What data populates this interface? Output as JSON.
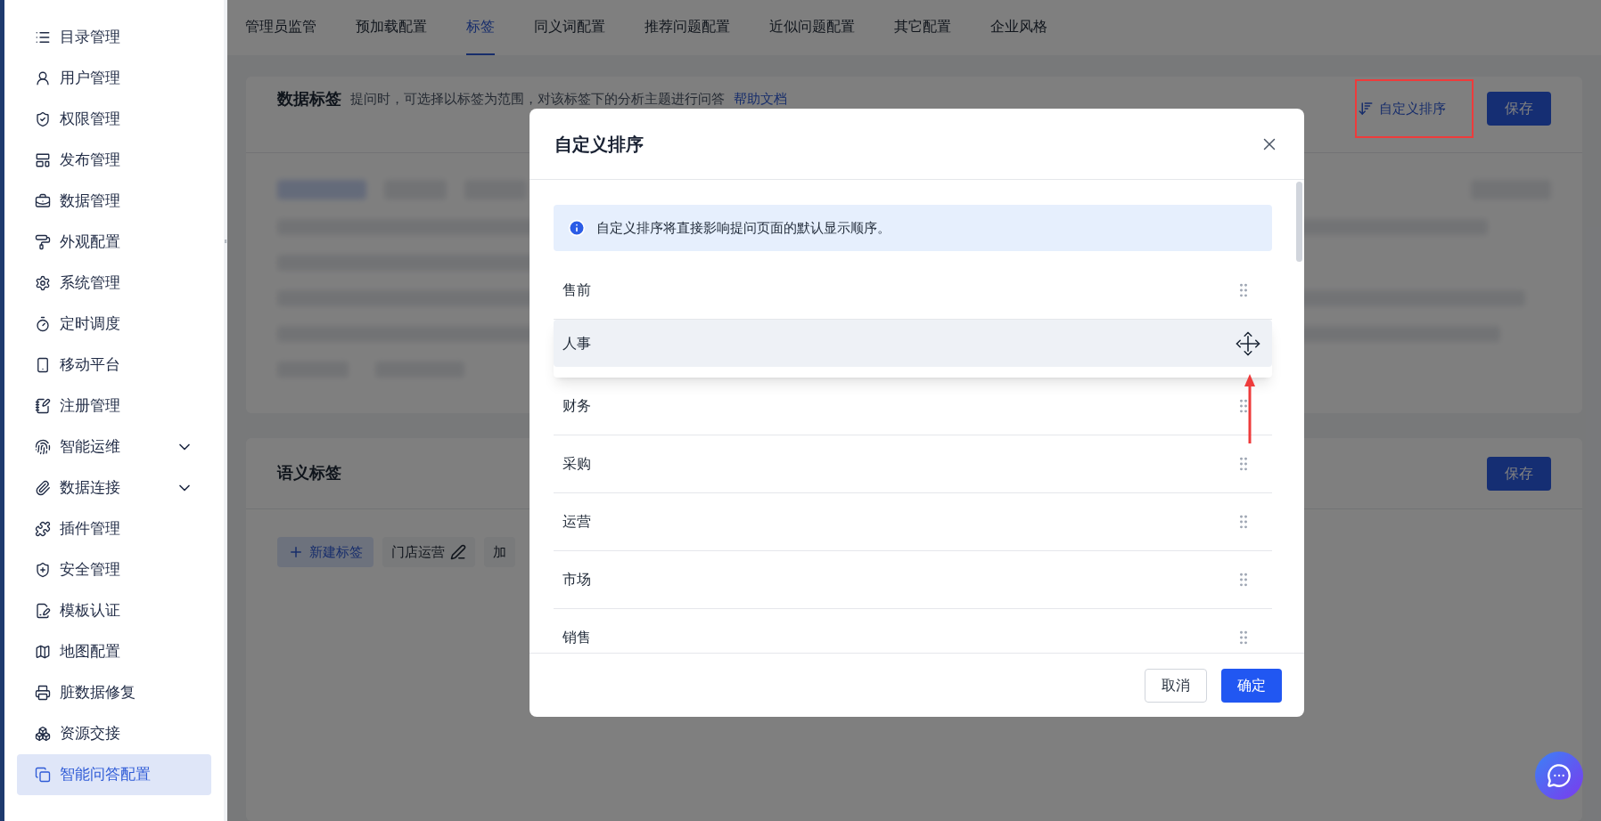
{
  "sidebar": {
    "items": [
      {
        "label": "目录管理",
        "kind": "link",
        "selected": false
      },
      {
        "label": "用户管理",
        "kind": "link",
        "selected": false
      },
      {
        "label": "权限管理",
        "kind": "link",
        "selected": false
      },
      {
        "label": "发布管理",
        "kind": "link",
        "selected": false
      },
      {
        "label": "数据管理",
        "kind": "link",
        "selected": false
      },
      {
        "label": "外观配置",
        "kind": "link",
        "selected": false
      },
      {
        "label": "系统管理",
        "kind": "link",
        "selected": false
      },
      {
        "label": "定时调度",
        "kind": "link",
        "selected": false
      },
      {
        "label": "移动平台",
        "kind": "link",
        "selected": false
      },
      {
        "label": "注册管理",
        "kind": "link",
        "selected": false
      },
      {
        "label": "智能运维",
        "kind": "group",
        "expanded": false,
        "selected": false
      },
      {
        "label": "数据连接",
        "kind": "group",
        "expanded": false,
        "selected": false
      },
      {
        "label": "插件管理",
        "kind": "link",
        "selected": false
      },
      {
        "label": "安全管理",
        "kind": "link",
        "selected": false
      },
      {
        "label": "模板认证",
        "kind": "link",
        "selected": false
      },
      {
        "label": "地图配置",
        "kind": "link",
        "selected": false
      },
      {
        "label": "脏数据修复",
        "kind": "link",
        "selected": false
      },
      {
        "label": "资源交接",
        "kind": "link",
        "selected": false
      },
      {
        "label": "智能问答配置",
        "kind": "link",
        "selected": true
      }
    ]
  },
  "tabs": [
    {
      "label": "管理员监管",
      "selected": false
    },
    {
      "label": "预加载配置",
      "selected": false
    },
    {
      "label": "标签",
      "selected": true
    },
    {
      "label": "同义词配置",
      "selected": false
    },
    {
      "label": "推荐问题配置",
      "selected": false
    },
    {
      "label": "近似问题配置",
      "selected": false
    },
    {
      "label": "其它配置",
      "selected": false
    },
    {
      "label": "企业风格",
      "selected": false
    }
  ],
  "data_tags": {
    "title": "数据标签",
    "hint": "提问时，可选择以标签为范围，对该标签下的分析主题进行问答",
    "help_link": "帮助文档",
    "sort_button": "自定义排序",
    "save_button": "保存"
  },
  "semantic_tags": {
    "title": "语义标签",
    "save_button": "保存",
    "new_tag_button": "新建标签",
    "tags": [
      "门店运营",
      "加"
    ]
  },
  "dialog": {
    "title": "自定义排序",
    "notice": "自定义排序将直接影响提问页面的默认显示顺序。",
    "items": [
      {
        "label": "售前",
        "dragging": false
      },
      {
        "label": "人事",
        "dragging": true
      },
      {
        "label": "财务",
        "dragging": false
      },
      {
        "label": "采购",
        "dragging": false
      },
      {
        "label": "运营",
        "dragging": false
      },
      {
        "label": "市场",
        "dragging": false
      },
      {
        "label": "销售",
        "dragging": false
      }
    ],
    "cancel_button": "取消",
    "confirm_button": "确定"
  }
}
